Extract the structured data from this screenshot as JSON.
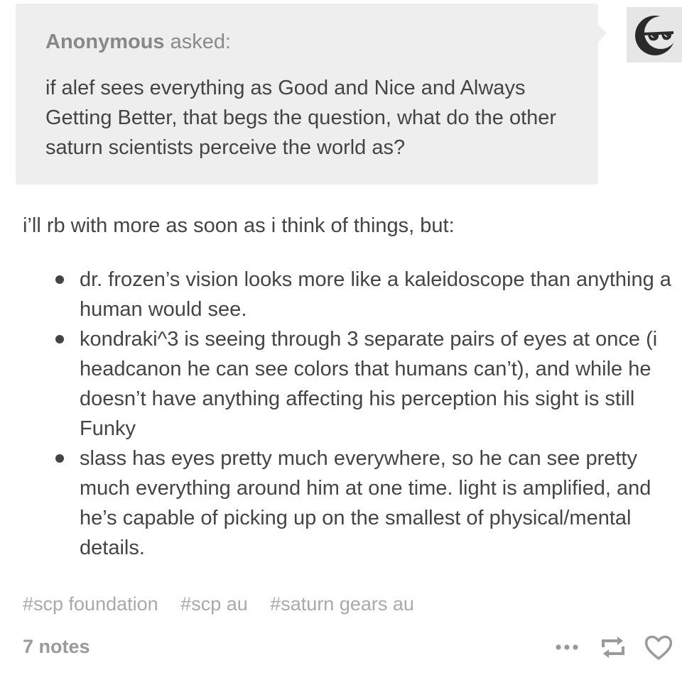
{
  "ask": {
    "asker_name": "Anonymous",
    "asked_label": "asked:",
    "question": "if alef sees everything as Good and Nice and Always Getting Better, that begs the question, what do the other saturn scientists perceive the world as?"
  },
  "avatar": {
    "icon": "sunglasses-moon-avatar-icon"
  },
  "answer": {
    "intro": "i’ll rb with more as soon as i think of things, but:",
    "bullets": [
      "dr. frozen’s vision looks more like a kaleidoscope than anything a human would see.",
      "kondraki^3 is seeing through 3 separate pairs of eyes at once (i headcanon he can see colors that humans can’t), and while he doesn’t have anything affecting his perception his sight is still Funky",
      "slass has eyes pretty much everywhere, so he can see pretty much everything around him at one time. light is amplified, and he’s capable of picking up on the smallest of physical/mental details."
    ]
  },
  "tags": [
    "#scp foundation",
    "#scp au",
    "#saturn gears au"
  ],
  "footer": {
    "notes": "7 notes",
    "icons": [
      "more-options-icon",
      "reblog-icon",
      "like-heart-icon"
    ]
  },
  "colors": {
    "ask_background": "#eeeeee",
    "text": "#444444",
    "muted": "#a9a9a9",
    "icon": "#9a9a9a"
  }
}
